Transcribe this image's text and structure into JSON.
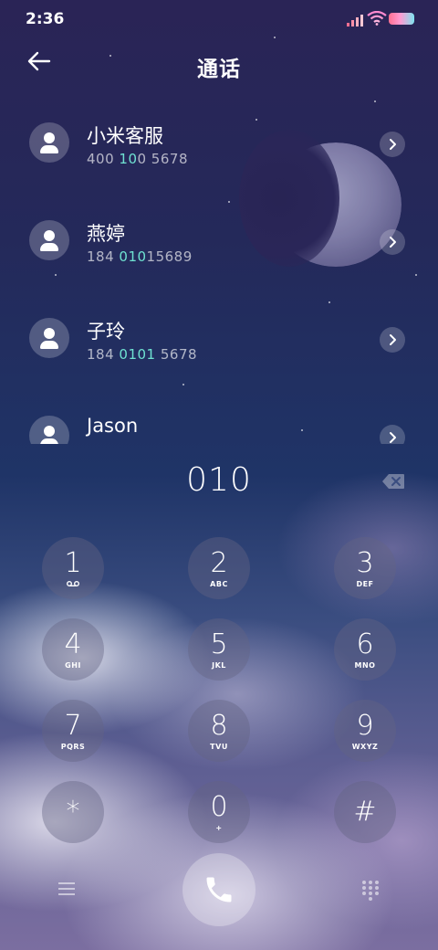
{
  "status_bar": {
    "time": "2:36"
  },
  "header": {
    "title": "通话"
  },
  "contacts": [
    {
      "name": "小米客服",
      "number_parts": [
        {
          "t": "400 "
        },
        {
          "t": "10",
          "hl": true
        },
        {
          "t": "0 5678"
        }
      ]
    },
    {
      "name": "燕婷",
      "number_parts": [
        {
          "t": "184 "
        },
        {
          "t": "010",
          "hl": true
        },
        {
          "t": "15689"
        }
      ]
    },
    {
      "name": "子玲",
      "number_parts": [
        {
          "t": "184 "
        },
        {
          "t": "0101",
          "hl": true
        },
        {
          "t": " 5678"
        }
      ]
    },
    {
      "name": "Jason",
      "number_parts": []
    }
  ],
  "dialer": {
    "input": "010"
  },
  "keypad": [
    {
      "digit": "1",
      "letters": ""
    },
    {
      "digit": "2",
      "letters": "ABC"
    },
    {
      "digit": "3",
      "letters": "DEF"
    },
    {
      "digit": "4",
      "letters": "GHI"
    },
    {
      "digit": "5",
      "letters": "JKL"
    },
    {
      "digit": "6",
      "letters": "MNO"
    },
    {
      "digit": "7",
      "letters": "PQRS"
    },
    {
      "digit": "8",
      "letters": "TVU"
    },
    {
      "digit": "9",
      "letters": "WXYZ"
    },
    {
      "digit": "*",
      "letters": ""
    },
    {
      "digit": "0",
      "letters": "+"
    },
    {
      "digit": "#",
      "letters": ""
    }
  ],
  "colors": {
    "highlight": "#6fe2d1",
    "key_bg": "#646482"
  }
}
